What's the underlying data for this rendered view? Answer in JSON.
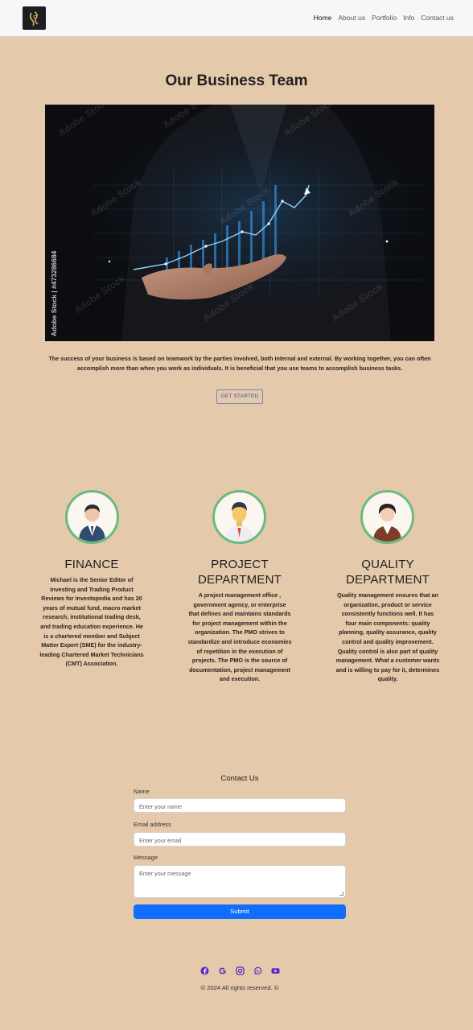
{
  "nav": {
    "logo": "logo-icon",
    "links": [
      "Home",
      "About us",
      "Portfolio",
      "Info",
      "Contact us"
    ]
  },
  "hero": {
    "title": "Our Business Team",
    "watermark": "Adobe Stock | #473286684",
    "text": "The success of your business is based on teamwork by the parties involved, both internal and external. By working together, you can often accomplish more than when you work as individuals. It is beneficial that you use teams to accomplish business tasks.",
    "cta": "GET STARTED"
  },
  "team": [
    {
      "title": "FINANCE",
      "text": "Michael is the Senior Editor of Investing and Trading Product Reviews for Investopedia and has 20 years of mutual fund, macro market research, institutional trading desk, and trading education experience. He is a chartered member and Subject Matter Expert (SME) for the industry-leading Chartered Market Technicians (CMT) Association."
    },
    {
      "title": "PROJECT DEPARTMENT",
      "text": "A project management office , government agency, or enterprise that defines and maintains standards for project management within the organization. The PMO strives to standardize and introduce economies of repetition in the execution of projects. The PMO is the source of documentation, project management and execution."
    },
    {
      "title": "QUALITY DEPARTMENT",
      "text": "Quality management ensures that an organization, product or service consistently functions well. It has four main components: quality planning, quality assurance, quality control and quality improvement. Quality control is also part of quality management. What a customer wants and is willing to pay for it, determines quality."
    }
  ],
  "contact": {
    "title": "Contact Us",
    "name_label": "Name",
    "name_placeholder": "Enter your name",
    "email_label": "Email address",
    "email_placeholder": "Enter your email",
    "message_label": "Message",
    "message_placeholder": "Enter your message",
    "submit": "Submit"
  },
  "footer": {
    "socials": [
      "facebook-icon",
      "google-icon",
      "instagram-icon",
      "whatsapp-icon",
      "youtube-icon"
    ],
    "copyright": "© 2024 All rights reserved. ©"
  },
  "colors": {
    "background": "#e4c9ab",
    "navbar": "#f7f7f9",
    "accent_green": "#6bba7d",
    "submit_blue": "#116dfb",
    "social_purple": "#5b2dbf"
  }
}
